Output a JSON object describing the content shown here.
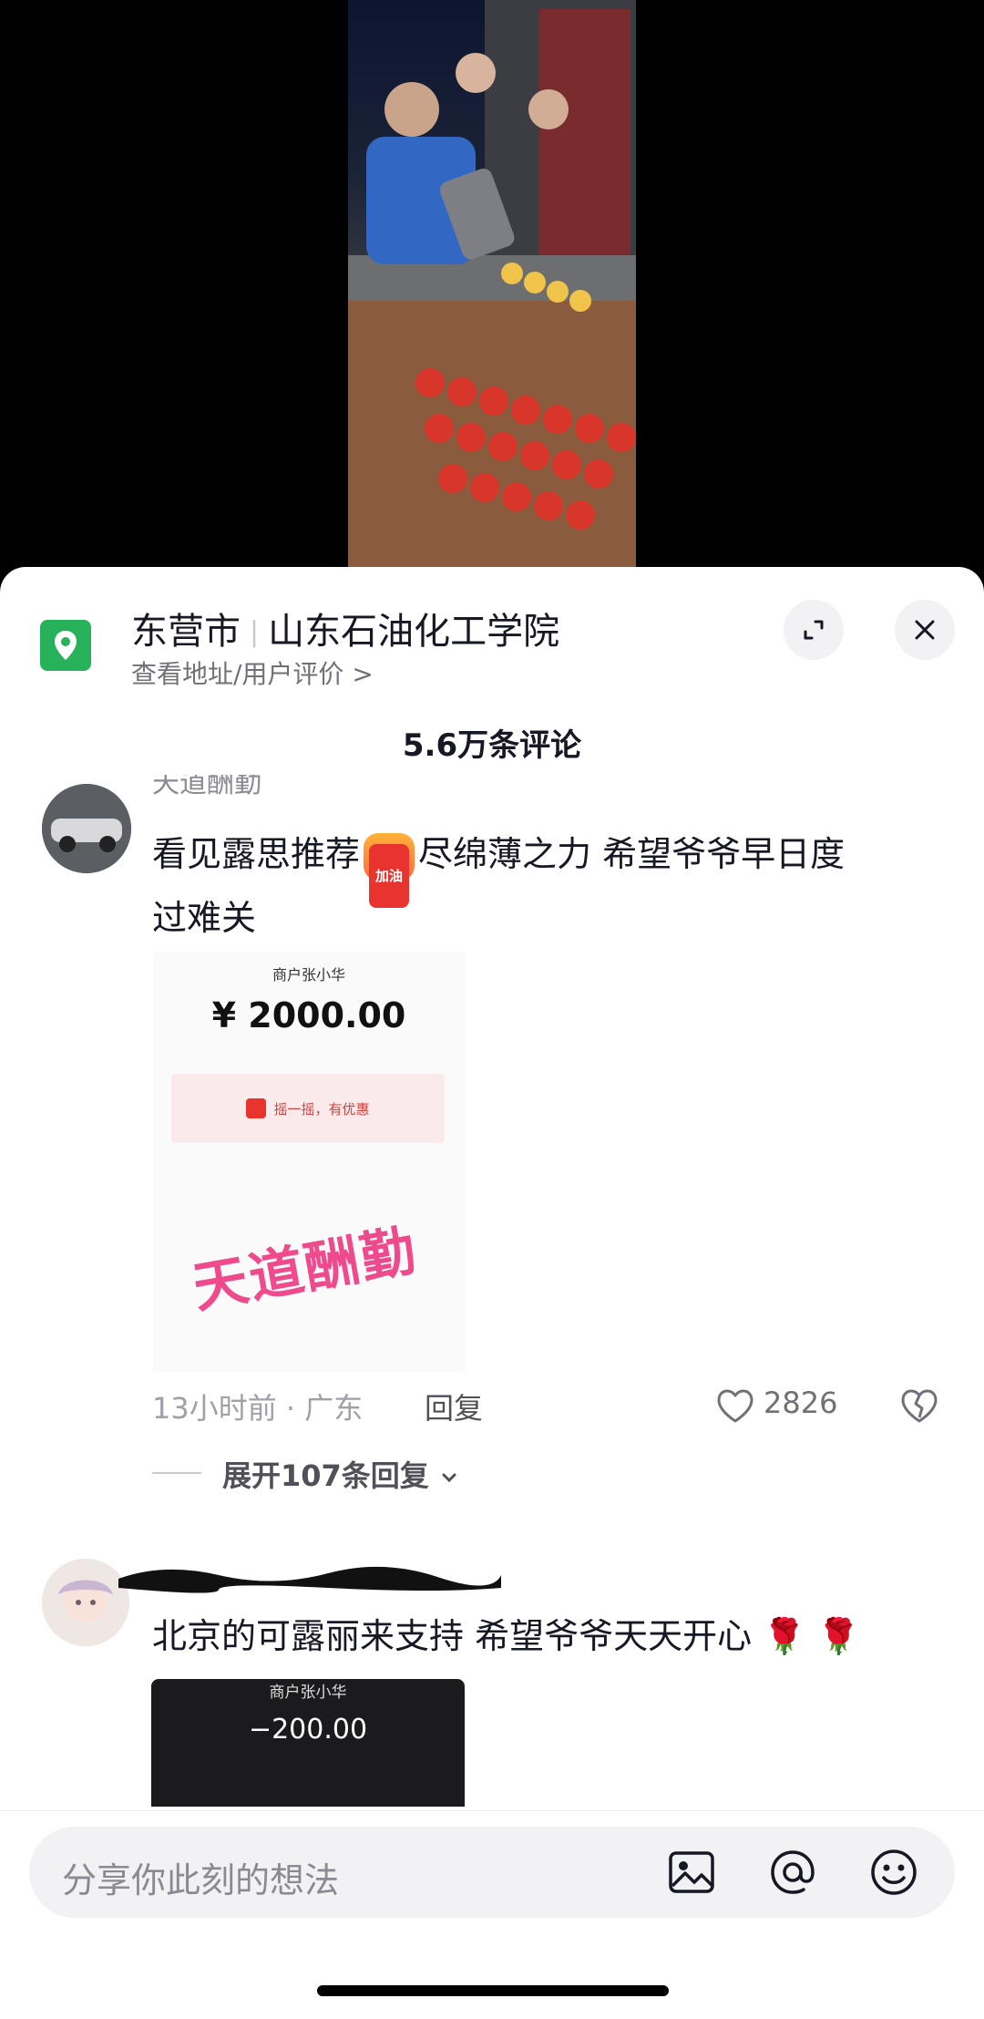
{
  "location": {
    "city": "东营市",
    "place": "山东石油化工学院",
    "subtitle": "查看地址/用户评价 >"
  },
  "comments_header": {
    "count_label": "5.6万条评论"
  },
  "comments": [
    {
      "author": "天道酬勤",
      "text_line1_before": "看见露思推荐",
      "badge_text": "加油",
      "text_line1_after": "尽绵薄之力 希望爷爷早日度",
      "text_line2": "过难关",
      "receipt": {
        "merchant": "商户张小华",
        "amount": "¥ 2000.00",
        "promo": "摇一摇，有优惠",
        "stamp": "天道酬勤"
      },
      "meta": "13小时前 · 广东",
      "reply_label": "回复",
      "likes": "2826",
      "expand_label": "展开107条回复"
    },
    {
      "text": "北京的可露丽来支持 希望爷爷天天开心",
      "emoji": "🌹 🌹",
      "receipt": {
        "merchant": "商户张小华",
        "amount": "−200.00"
      }
    }
  ],
  "input": {
    "placeholder": "分享你此刻的想法"
  },
  "colors": {
    "location_icon": "#27b15a",
    "stamp": "#ee4a8c",
    "promo_bg": "#fbeaec"
  },
  "icons": [
    "location-pin-icon",
    "expand-icon",
    "close-icon",
    "heart-icon",
    "dislike-icon",
    "chevron-down-icon",
    "image-icon",
    "at-icon",
    "emoji-icon"
  ]
}
